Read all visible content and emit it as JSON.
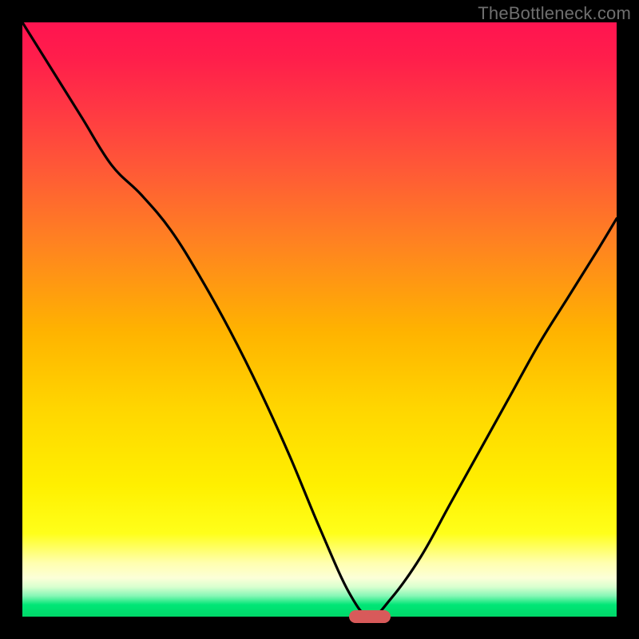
{
  "watermark": "TheBottleneck.com",
  "colors": {
    "frame_bg_top": "#ff1450",
    "frame_bg_bottom": "#00d869",
    "curve": "#000000",
    "marker": "#d85a5a",
    "page_bg": "#000000",
    "watermark": "#6f6f6f"
  },
  "chart_data": {
    "type": "line",
    "title": "",
    "xlabel": "",
    "ylabel": "",
    "xlim": [
      0,
      100
    ],
    "ylim": [
      0,
      100
    ],
    "grid": false,
    "legend": false,
    "annotations": [
      "TheBottleneck.com"
    ],
    "marker": {
      "x_start": 55,
      "x_end": 62,
      "y": 0
    },
    "series": [
      {
        "name": "bottleneck-curve",
        "x": [
          0,
          5,
          10,
          15,
          20,
          25,
          30,
          35,
          40,
          45,
          50,
          55,
          58.5,
          62,
          67,
          72,
          77,
          82,
          87,
          92,
          97,
          100
        ],
        "values": [
          100,
          92,
          84,
          76,
          71,
          65,
          57,
          48,
          38,
          27,
          15,
          4,
          0,
          3,
          10,
          19,
          28,
          37,
          46,
          54,
          62,
          67
        ]
      }
    ]
  }
}
